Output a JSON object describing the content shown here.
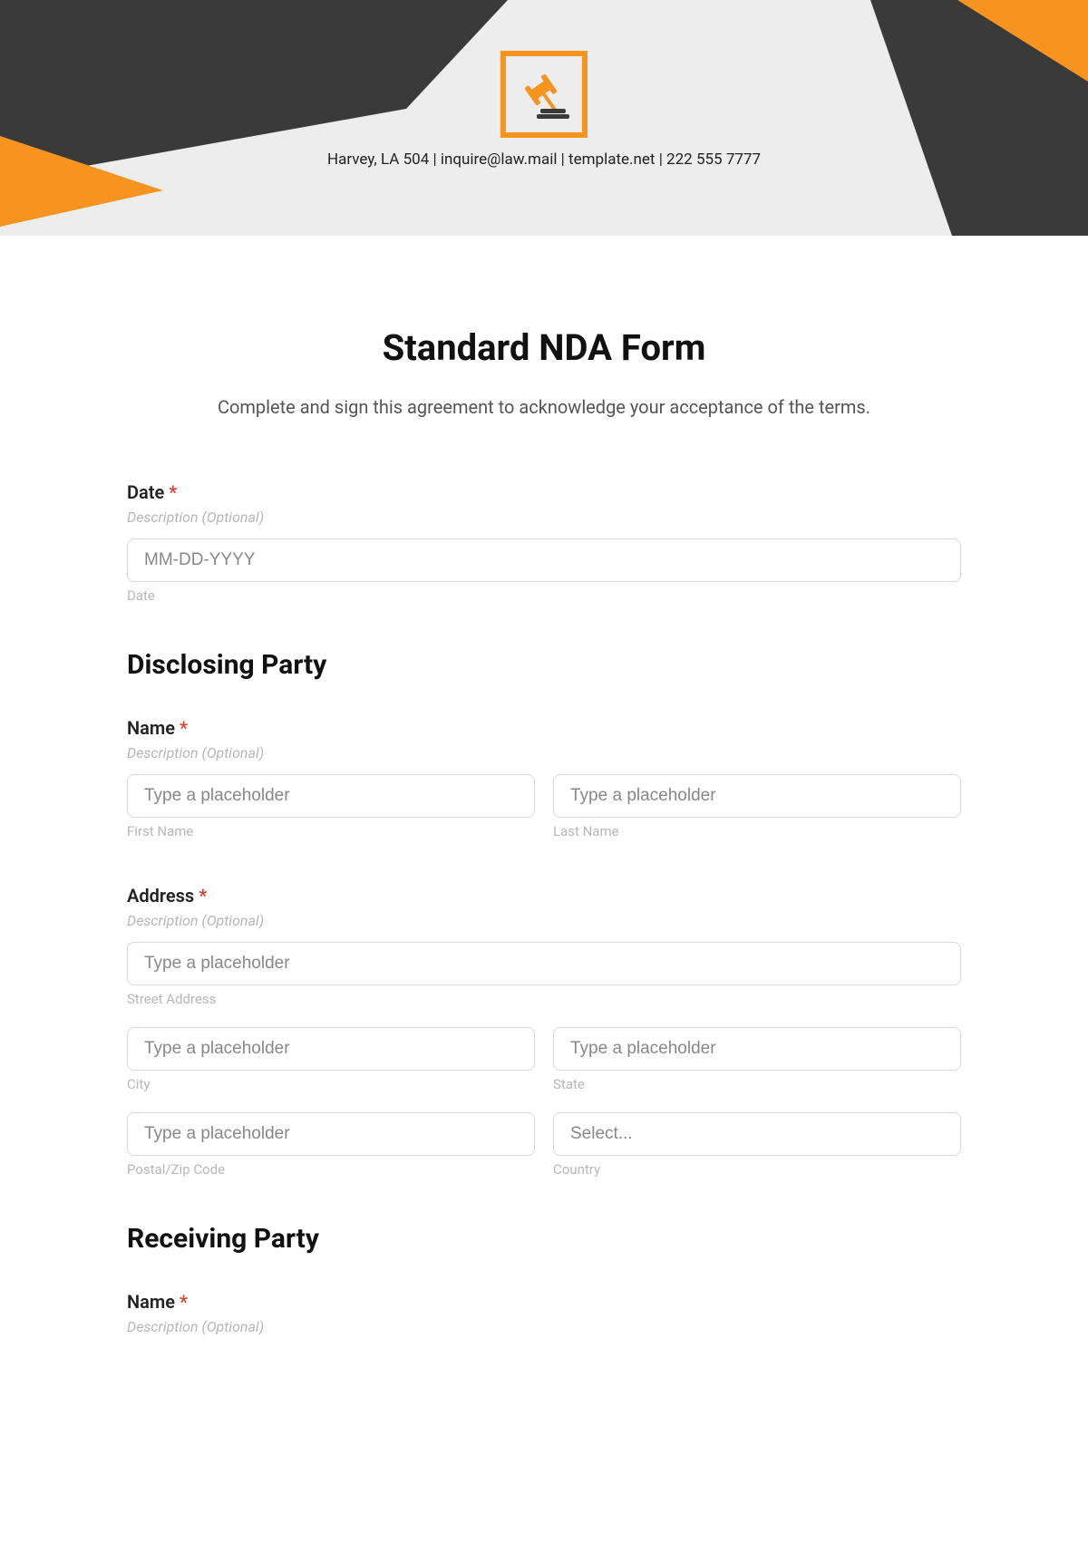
{
  "header": {
    "contact": "Harvey, LA 504  | inquire@law.mail  | template.net | 222 555 7777"
  },
  "title": "Standard NDA Form",
  "subtitle": "Complete and sign this agreement to acknowledge your acceptance of the terms.",
  "common": {
    "description_hint": "Description (Optional)",
    "placeholder": "Type a placeholder",
    "select_placeholder": "Select..."
  },
  "date_field": {
    "label": "Date",
    "placeholder": "MM-DD-YYYY",
    "sublabel": "Date"
  },
  "disclosing": {
    "heading": "Disclosing Party",
    "name": {
      "label": "Name",
      "first_sub": "First Name",
      "last_sub": "Last Name"
    },
    "address": {
      "label": "Address",
      "street_sub": "Street Address",
      "city_sub": "City",
      "state_sub": "State",
      "postal_sub": "Postal/Zip Code",
      "country_sub": "Country"
    }
  },
  "receiving": {
    "heading": "Receiving Party",
    "name": {
      "label": "Name"
    }
  }
}
